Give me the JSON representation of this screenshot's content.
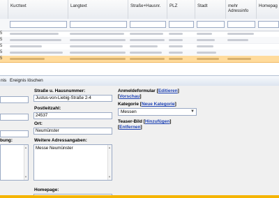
{
  "grid": {
    "columns": [
      {
        "label": "Kurztext"
      },
      {
        "label": "Langtext"
      },
      {
        "label": "Straße+Hausnr."
      },
      {
        "label": "PLZ"
      },
      {
        "label": "Stadt"
      },
      {
        "label": "mehr Adressinfo"
      },
      {
        "label": "Homepag"
      }
    ],
    "row_index_labels": [
      "5",
      "5",
      "5",
      "5",
      "5"
    ],
    "selected_row": 4
  },
  "toolbar": {
    "item1": "nis",
    "item2": "Ereignis löschen"
  },
  "form": {
    "street_label": "Straße u. Hausnummer:",
    "street_value": "Justus-von-Liebig-Straße 2-4",
    "plz_label": "Postleitzahl:",
    "plz_value": "24537",
    "city_label": "Ort:",
    "city_value": "Neumünster",
    "left_label": "bung:",
    "further_label": "Weitere Adressangaben:",
    "further_value": "Messe Neumünster",
    "homepage_label": "Homepage:",
    "anmelde_label": "Anmeldeformular",
    "anmelde_edit": "Editieren",
    "anmelde_preview": "Vorschau",
    "kategorie_label": "Kategorie",
    "kategorie_new": "Neue Kategorie",
    "kategorie_value": "Messen",
    "teaser_label": "Teaser-Bild",
    "teaser_add": "Hinzufügen",
    "teaser_remove": "Entfernen"
  },
  "colors": {
    "selected_row": "#ffdb9c",
    "link": "#1a3fb3",
    "bottom_accent": "#f5b400"
  }
}
